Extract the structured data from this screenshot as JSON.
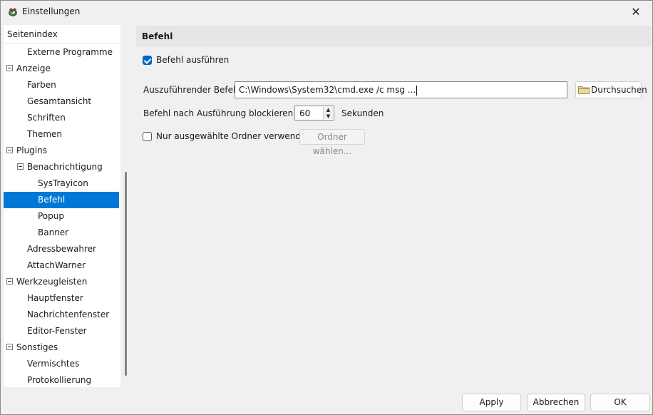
{
  "window": {
    "title": "Einstellungen"
  },
  "sidebar": {
    "header": "Seitenindex",
    "items": [
      {
        "label": "Externe Programme",
        "level": 1,
        "expander": false,
        "selected": false
      },
      {
        "label": "Anzeige",
        "level": 0,
        "expander": true,
        "selected": false
      },
      {
        "label": "Farben",
        "level": 1,
        "expander": false,
        "selected": false
      },
      {
        "label": "Gesamtansicht",
        "level": 1,
        "expander": false,
        "selected": false
      },
      {
        "label": "Schriften",
        "level": 1,
        "expander": false,
        "selected": false
      },
      {
        "label": "Themen",
        "level": 1,
        "expander": false,
        "selected": false
      },
      {
        "label": "Plugins",
        "level": 0,
        "expander": true,
        "selected": false
      },
      {
        "label": "Benachrichtigung",
        "level": 1,
        "expander": true,
        "selected": false
      },
      {
        "label": "SysTrayicon",
        "level": 2,
        "expander": false,
        "selected": false
      },
      {
        "label": "Befehl",
        "level": 2,
        "expander": false,
        "selected": true
      },
      {
        "label": "Popup",
        "level": 2,
        "expander": false,
        "selected": false
      },
      {
        "label": "Banner",
        "level": 2,
        "expander": false,
        "selected": false
      },
      {
        "label": "Adressbewahrer",
        "level": 1,
        "expander": false,
        "selected": false
      },
      {
        "label": "AttachWarner",
        "level": 1,
        "expander": false,
        "selected": false
      },
      {
        "label": "Werkzeugleisten",
        "level": 0,
        "expander": true,
        "selected": false
      },
      {
        "label": "Hauptfenster",
        "level": 1,
        "expander": false,
        "selected": false
      },
      {
        "label": "Nachrichtenfenster",
        "level": 1,
        "expander": false,
        "selected": false
      },
      {
        "label": "Editor-Fenster",
        "level": 1,
        "expander": false,
        "selected": false
      },
      {
        "label": "Sonstiges",
        "level": 0,
        "expander": true,
        "selected": false
      },
      {
        "label": "Vermischtes",
        "level": 1,
        "expander": false,
        "selected": false
      },
      {
        "label": "Protokollierung",
        "level": 1,
        "expander": false,
        "selected": false
      }
    ]
  },
  "panel": {
    "title": "Befehl",
    "execute_checkbox": {
      "label": "Befehl ausführen",
      "checked": true
    },
    "command": {
      "label": "Auszuführender Befehl",
      "value": "C:\\Windows\\System32\\cmd.exe /c msg ...",
      "browse_label": "Durchsuchen"
    },
    "block": {
      "label": "Befehl nach Ausführung blockieren für",
      "value": "60",
      "unit": "Sekunden"
    },
    "folders_checkbox": {
      "label": "Nur ausgewählte Ordner verwenden",
      "checked": false,
      "button_label": "Ordner wählen..."
    }
  },
  "footer": {
    "apply": "Apply",
    "cancel": "Abbrechen",
    "ok": "OK"
  },
  "colors": {
    "selection": "#0078d7",
    "checkbox_accent": "#0067c0"
  },
  "icons": {
    "app": "app-icon",
    "close": "close-icon",
    "folder": "folder-icon",
    "spin_up": "arrow-up-icon",
    "spin_down": "arrow-down-icon"
  }
}
